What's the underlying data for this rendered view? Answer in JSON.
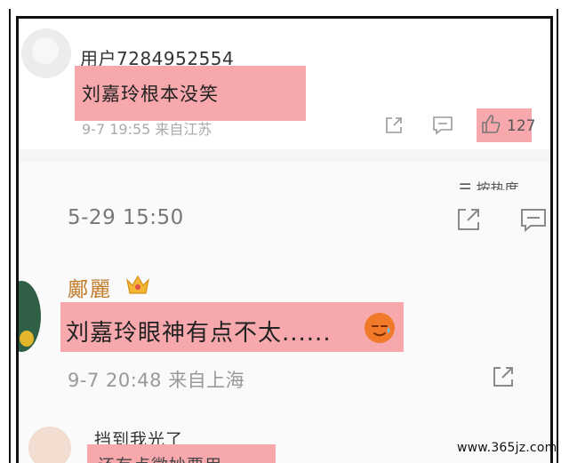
{
  "comment1": {
    "username": "用户7284952554",
    "text": "刘嘉玲根本没笑",
    "time": "9-7 19:55",
    "location": "来自江苏",
    "likes": "127",
    "icons": [
      "share-icon",
      "comment-icon",
      "like-icon"
    ]
  },
  "section2": {
    "sort_label": "按热度",
    "post_time": "5-29 15:50",
    "icons": [
      "share-icon",
      "comment-icon"
    ]
  },
  "comment2": {
    "username": "鄺麗",
    "badge": "crown-icon",
    "text": "刘嘉玲眼神有点不太......",
    "emoji": "sweat-smile-emoji",
    "time": "9-7 20:48",
    "location": "来自上海"
  },
  "comment3": {
    "username": "挡到我光了",
    "text": "还有点微妙要用"
  },
  "watermark": "www.365jz.com",
  "colors": {
    "highlight": "#f6a8ac",
    "username_gold": "#c27d2a",
    "meta_gray": "#999999"
  }
}
